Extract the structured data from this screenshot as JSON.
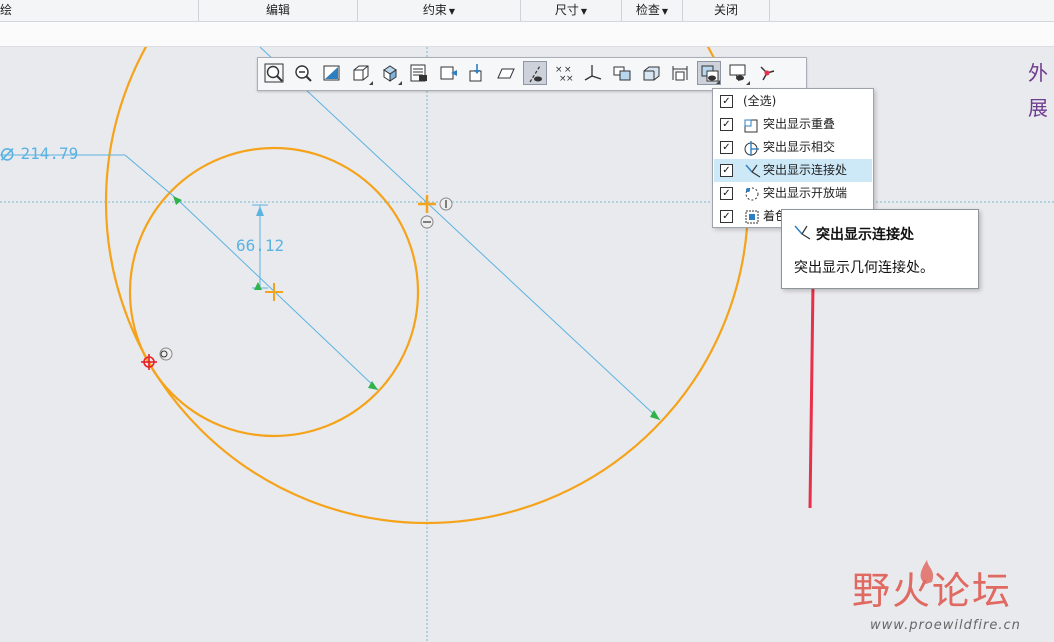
{
  "ribbon": {
    "groups": [
      {
        "label": "绘",
        "dropdown": false
      },
      {
        "label": "编辑",
        "dropdown": false
      },
      {
        "label": "约束",
        "dropdown": true
      },
      {
        "label": "尺寸",
        "dropdown": true
      },
      {
        "label": "检查",
        "dropdown": true
      },
      {
        "label": "关闭",
        "dropdown": false
      }
    ]
  },
  "toolbar": {
    "buttons": [
      {
        "name": "refit-icon"
      },
      {
        "name": "zoom-out-icon"
      },
      {
        "name": "repaint-icon"
      },
      {
        "name": "display-style-icon"
      },
      {
        "name": "saved-orientations-icon"
      },
      {
        "name": "view-manager-icon"
      },
      {
        "name": "sketch-view-icon"
      },
      {
        "name": "datum-display-icon"
      },
      {
        "name": "plane-display-icon"
      },
      {
        "name": "axis-display-icon"
      },
      {
        "name": "point-display-icon"
      },
      {
        "name": "csys-display-icon"
      },
      {
        "name": "annotation-display-icon"
      },
      {
        "name": "spin-center-icon"
      },
      {
        "name": "dimension-display-icon"
      },
      {
        "name": "sketcher-display-icon"
      },
      {
        "name": "highlight-filter-icon"
      },
      {
        "name": "open-ends-icon"
      }
    ]
  },
  "highlight_menu": {
    "items": [
      {
        "label": "(全选)",
        "checked": true,
        "icon": ""
      },
      {
        "label": "突出显示重叠",
        "checked": true,
        "icon": "overlap-icon"
      },
      {
        "label": "突出显示相交",
        "checked": true,
        "icon": "intersect-icon"
      },
      {
        "label": "突出显示连接处",
        "checked": true,
        "icon": "connection-icon",
        "hover": true
      },
      {
        "label": "突出显示开放端",
        "checked": true,
        "icon": "open-end-icon"
      },
      {
        "label": "着色",
        "checked": true,
        "icon": "shade-icon"
      }
    ],
    "check_mark": "✓"
  },
  "tooltip": {
    "title": "突出显示连接处",
    "description": "突出显示几何连接处。"
  },
  "sketch": {
    "dim_diameter": "214.79",
    "dim_diameter_symbol": "∅",
    "dim_radius": "66.12"
  },
  "side_text": {
    "line1": "外",
    "line2": "展"
  },
  "watermark": {
    "brand": "野火论坛",
    "url": "www.proewildfire.cn"
  },
  "colors": {
    "geometry": "#f5a31a",
    "dimension": "#5bb3e1",
    "centerline": "#7ab8cf",
    "arrow": "#e8304a",
    "side_text": "#6f3a8f"
  }
}
